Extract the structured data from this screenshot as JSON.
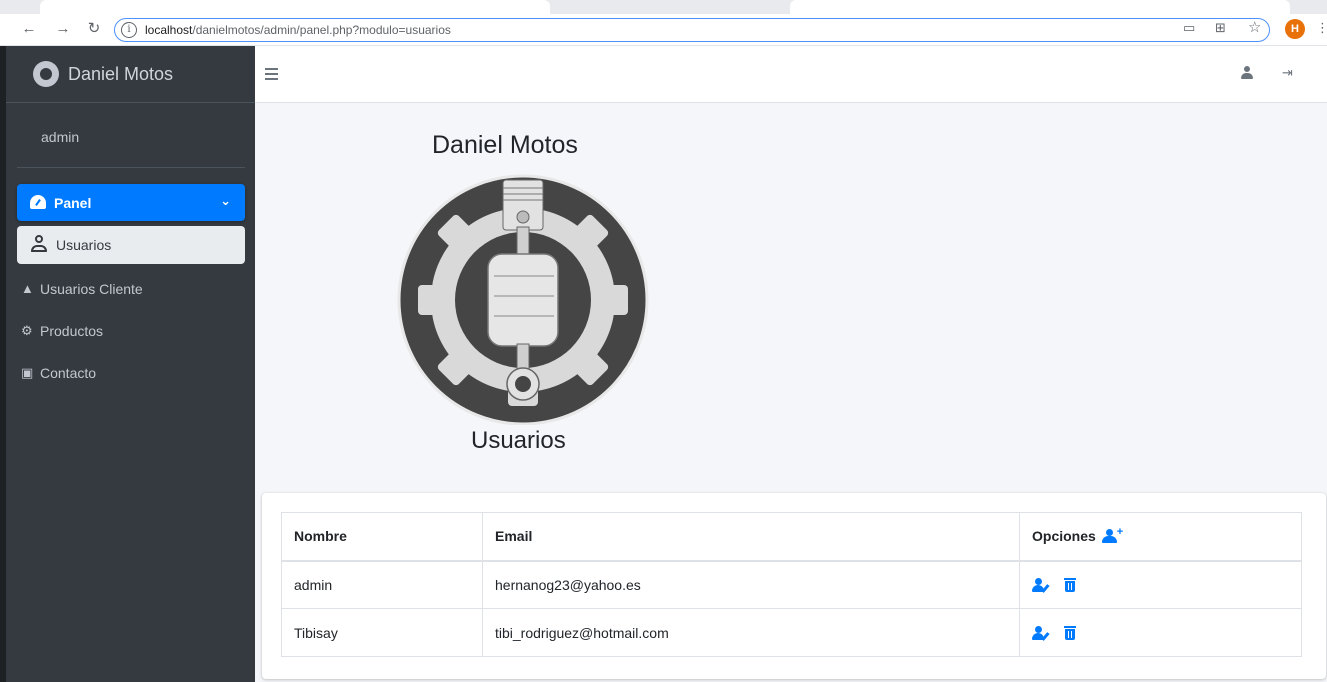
{
  "browser": {
    "url_host": "localhost",
    "url_path": "/danielmotos/admin/panel.php?modulo=usuarios",
    "profile_initial": "H"
  },
  "sidebar": {
    "brand_title": "Daniel Motos",
    "user_name": "admin",
    "menu": {
      "panel_label": "Panel",
      "usuarios_label": "Usuarios",
      "items": [
        {
          "label": "Usuarios Cliente",
          "icon": "car-icon"
        },
        {
          "label": "Productos",
          "icon": "motorcycle-icon"
        },
        {
          "label": "Contacto",
          "icon": "address-book-icon"
        }
      ]
    }
  },
  "content": {
    "hero_title": "Daniel Motos",
    "hero_subtitle": "Usuarios",
    "table": {
      "headers": [
        "Nombre",
        "Email",
        "Opciones"
      ],
      "rows": [
        {
          "nombre": "admin",
          "email": "hernanog23@yahoo.es"
        },
        {
          "nombre": "Tibisay",
          "email": "tibi_rodriguez@hotmail.com"
        }
      ]
    }
  },
  "colors": {
    "sidebar_bg": "#343a40",
    "accent": "#007bff",
    "active_item_bg": "#e9ecef",
    "content_bg": "#f4f6f9"
  }
}
